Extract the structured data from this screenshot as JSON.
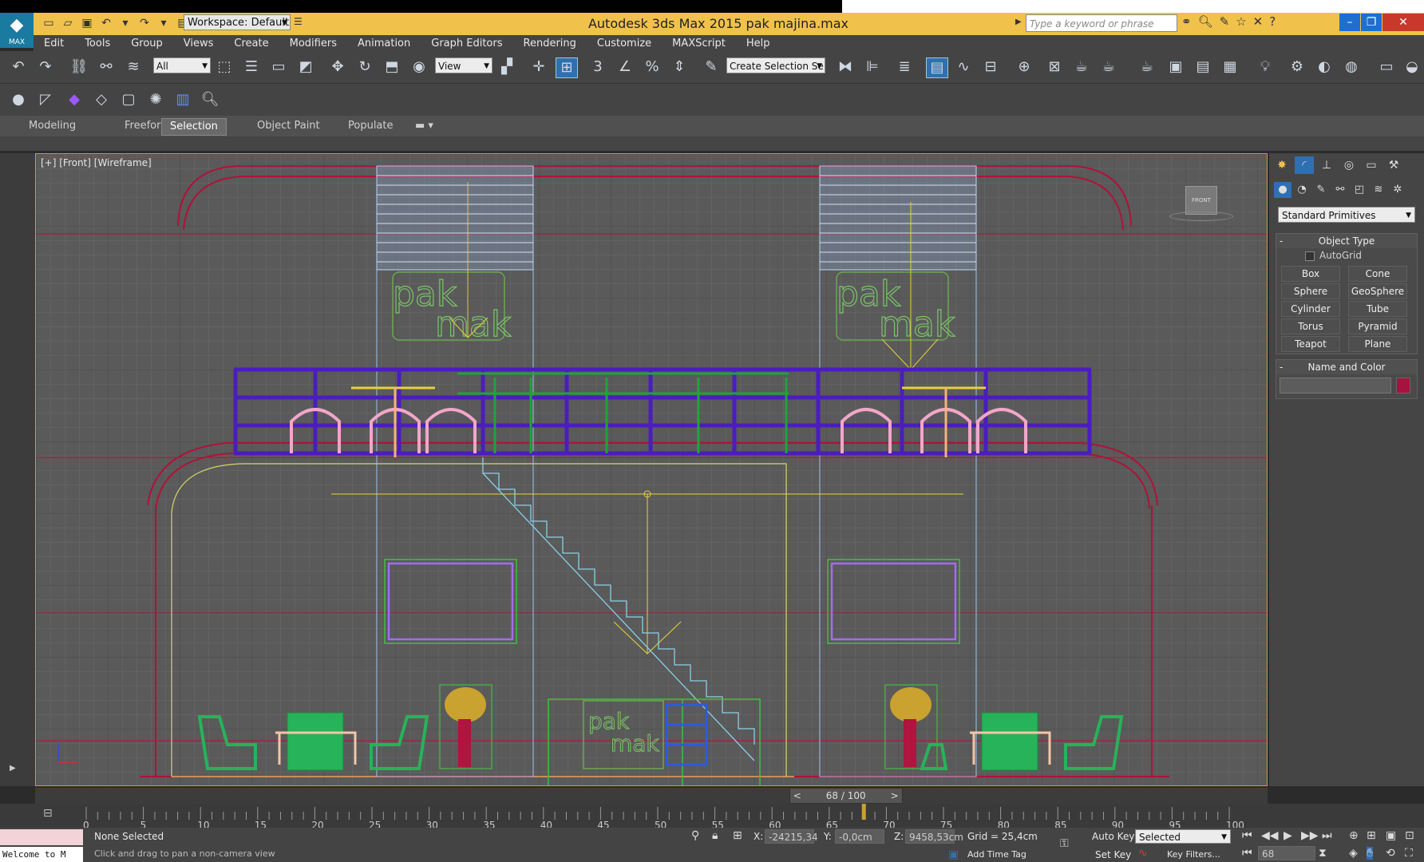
{
  "app": {
    "title": "Autodesk 3ds Max  2015     pak majina.max",
    "logo_text": "MAX",
    "workspace": "Workspace: Default",
    "search_placeholder": "Type a keyword or phrase"
  },
  "menu": [
    "Edit",
    "Tools",
    "Group",
    "Views",
    "Create",
    "Modifiers",
    "Animation",
    "Graph Editors",
    "Rendering",
    "Customize",
    "MAXScript",
    "Help"
  ],
  "toolbar": {
    "selection_filter": "All",
    "reference_coord": "View",
    "named_selection_placeholder": "Create Selection Se"
  },
  "ribbon_tabs": [
    "Modeling",
    "Freeform",
    "Selection",
    "Object Paint",
    "Populate"
  ],
  "ribbon_active": "Selection",
  "viewport": {
    "label": "[+] [Front] [Wireframe]",
    "viewcube_label": "FRONT",
    "signage_text_line1": "pak",
    "signage_text_line2": "mak"
  },
  "command_panel": {
    "category": "Standard Primitives",
    "object_type_title": "Object Type",
    "autogrid_label": "AutoGrid",
    "primitives": [
      "Box",
      "Cone",
      "Sphere",
      "GeoSphere",
      "Cylinder",
      "Tube",
      "Torus",
      "Pyramid",
      "Teapot",
      "Plane"
    ],
    "name_color_title": "Name and Color",
    "object_color": "#a8123e"
  },
  "timeline": {
    "slider_label": "68 / 100",
    "current_frame": 68,
    "total_frames": 100,
    "ticks": [
      "0",
      "5",
      "10",
      "15",
      "20",
      "25",
      "30",
      "35",
      "40",
      "45",
      "50",
      "55",
      "60",
      "65",
      "70",
      "75",
      "80",
      "85",
      "90",
      "95",
      "100"
    ]
  },
  "status": {
    "selection": "None Selected",
    "prompt": "Click and drag to pan a non-camera view",
    "x_label": "X:",
    "x_value": "-24215,34",
    "y_label": "Y:",
    "y_value": "-0,0cm",
    "z_label": "Z:",
    "z_value": "9458,53cm",
    "grid": "Grid = 25,4cm",
    "auto_key": "Auto Key",
    "auto_key_mode": "Selected",
    "set_key": "Set Key",
    "key_filters": "Key Filters...",
    "add_time_tag": "Add Time Tag",
    "frame_field": "68",
    "maxscript_listener": "Welcome to M"
  },
  "colors": {
    "title_bar": "#f0c24b",
    "viewport_bg": "#5a5a5a",
    "active_border": "#d4a017"
  }
}
